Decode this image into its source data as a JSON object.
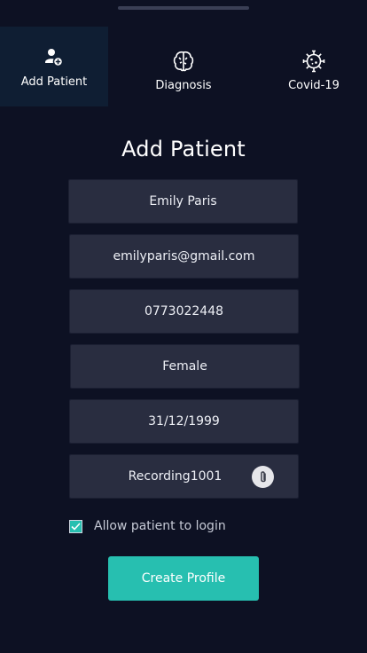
{
  "tabs": [
    {
      "label": "Add Patient",
      "icon": "add-user-icon"
    },
    {
      "label": "Diagnosis",
      "icon": "brain-icon"
    },
    {
      "label": "Covid-19",
      "icon": "virus-icon"
    }
  ],
  "form": {
    "title": "Add Patient",
    "name": "Emily Paris",
    "email": "emilyparis@gmail.com",
    "phone": "0773022448",
    "gender": "Female",
    "dob": "31/12/1999",
    "recording": "Recording1001",
    "allow_login_label": "Allow patient to login",
    "allow_login_checked": true,
    "submit_label": "Create Profile"
  },
  "colors": {
    "background": "#0d1123",
    "field": "#292d40",
    "accent": "#27bfb0",
    "active_tab": "#0f1e33"
  }
}
